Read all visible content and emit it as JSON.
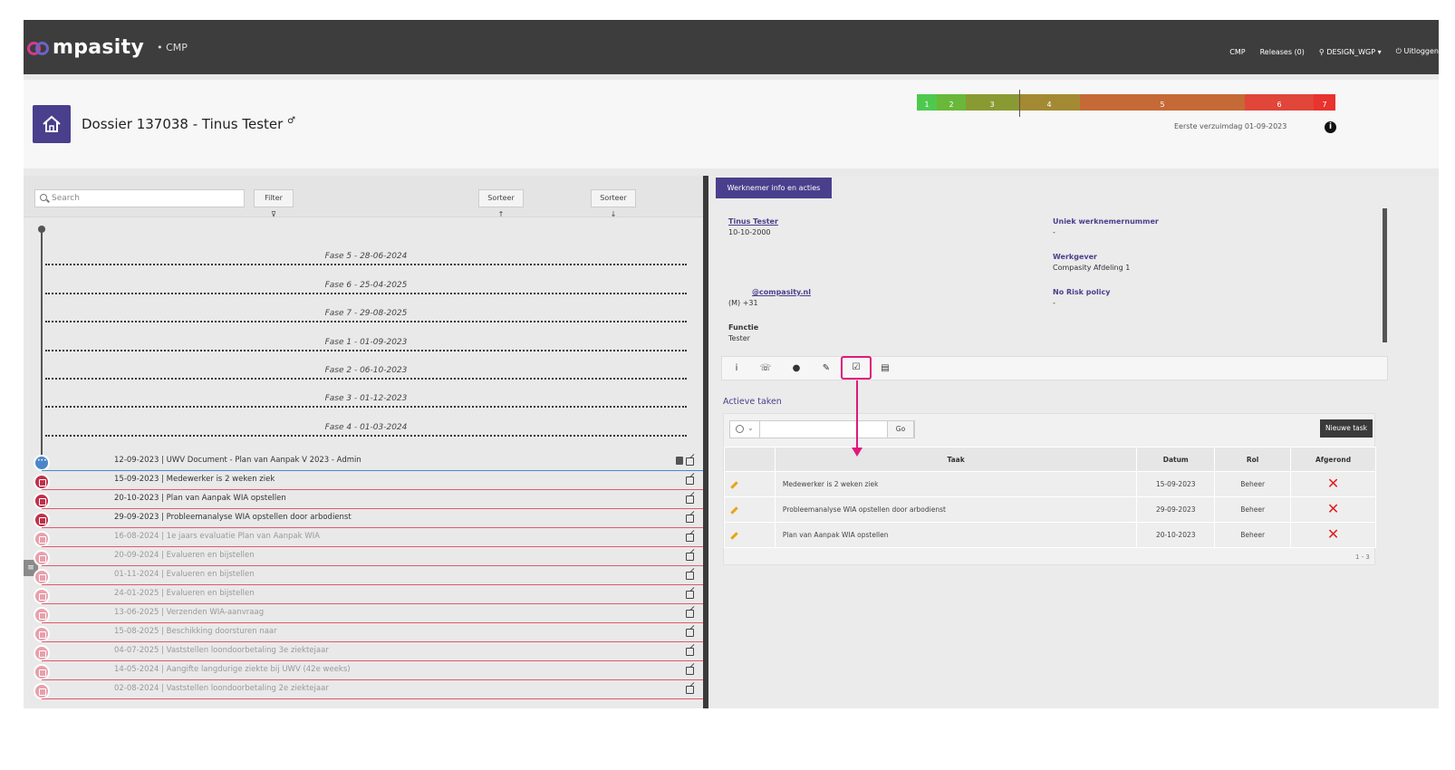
{
  "nav": {
    "logo_text": "mpasity",
    "logo_sub": "• CMP",
    "links": [
      "CMP",
      "Releases (0)",
      "DESIGN_WGP ▾",
      "Uitloggen"
    ],
    "user_icon": "user-icon",
    "logout_icon": "power-icon"
  },
  "header": {
    "title": "Dossier 137038 - Tinus Tester",
    "gender_symbol": "♂",
    "first_day": "Eerste verzuimdag 01-09-2023",
    "info_symbol": "i",
    "phases": [
      {
        "label": "1",
        "color": "#4ec94e"
      },
      {
        "label": "2",
        "color": "#6ab83a"
      },
      {
        "label": "3",
        "color": "#8a9a32"
      },
      {
        "label": "4",
        "color": "#a38a32"
      },
      {
        "label": "5",
        "color": "#c56a36"
      },
      {
        "label": "6",
        "color": "#e0463a"
      },
      {
        "label": "7",
        "color": "#e8332e"
      }
    ]
  },
  "left": {
    "search_placeholder": "Search",
    "filter_label": "Filter ⊽",
    "sort_up_label": "Sorteer ↑",
    "sort_down_label": "Sorteer ↓",
    "side_tab_symbol": "≡",
    "phases": [
      "Fase 5 - 28-06-2024",
      "Fase 6 - 25-04-2025",
      "Fase 7 - 29-08-2025",
      "Fase 1 - 01-09-2023",
      "Fase 2 - 06-10-2023",
      "Fase 3 - 01-12-2023",
      "Fase 4 - 01-03-2024"
    ],
    "events": [
      {
        "text": "12-09-2023 | UWV Document - Plan van Aanpak V 2023 - Admin"
      },
      {
        "text": "15-09-2023 | Medewerker is 2 weken ziek"
      },
      {
        "text": "20-10-2023 | Plan van Aanpak WIA opstellen"
      },
      {
        "text": "29-09-2023 | Probleemanalyse WIA opstellen door arbodienst"
      },
      {
        "text": "16-08-2024 | 1e jaars evaluatie Plan van Aanpak WIA"
      },
      {
        "text": "20-09-2024 | Evalueren en bijstellen"
      },
      {
        "text": "01-11-2024 | Evalueren en bijstellen"
      },
      {
        "text": "24-01-2025 | Evalueren en bijstellen"
      },
      {
        "text": "13-06-2025 | Verzenden WIA-aanvraag"
      },
      {
        "text": "15-08-2025 | Beschikking doorsturen naar"
      },
      {
        "text": "04-07-2025 | Vaststellen loondoorbetaling 3e ziektejaar"
      },
      {
        "text": "14-05-2024 | Aangifte langdurige ziekte bij UWV (42e weeks)"
      },
      {
        "text": "02-08-2024 | Vaststellen loondoorbetaling 2e ziektejaar"
      }
    ]
  },
  "right": {
    "tab_label": "Werknemer info en acties",
    "employee_name": "Tinus Tester",
    "birth_date": "10-10-2000",
    "unique_label": "Uniek werknemernummer",
    "unique_value": "-",
    "employer_label": "Werkgever",
    "employer_value": "Compasity Afdeling 1",
    "email": "@compasity.nl",
    "phone": "(M) +31",
    "norisk_label": "No Risk policy",
    "norisk_value": "-",
    "function_label": "Functie",
    "function_value": "Tester",
    "icons": [
      "i",
      "☏",
      "●",
      "✎",
      "☑",
      "▤"
    ],
    "tasks_title": "Actieve taken",
    "go_label": "Go",
    "new_task_label": "Nieuwe task",
    "columns": [
      "",
      "Taak",
      "Datum",
      "Rol",
      "Afgerond"
    ],
    "rows": [
      {
        "task": "Medewerker is 2 weken ziek",
        "date": "15-09-2023",
        "role": "Beheer",
        "done": "✕"
      },
      {
        "task": "Probleemanalyse WIA opstellen door arbodienst",
        "date": "29-09-2023",
        "role": "Beheer",
        "done": "✕"
      },
      {
        "task": "Plan van Aanpak WIA opstellen",
        "date": "20-10-2023",
        "role": "Beheer",
        "done": "✕"
      }
    ],
    "pager": "1 - 3"
  }
}
